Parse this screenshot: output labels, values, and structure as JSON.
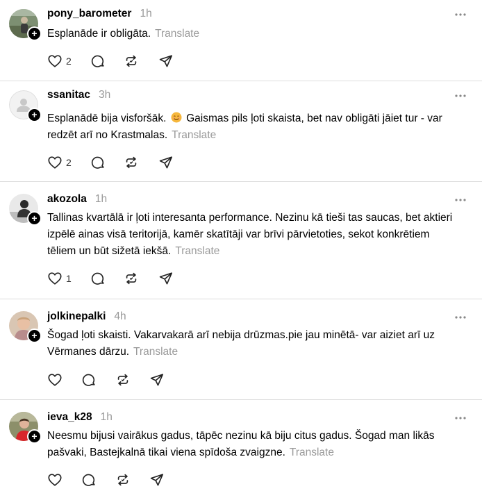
{
  "posts": [
    {
      "username": "pony_barometer",
      "time": "1h",
      "text": "Esplanāde ir obligāta.",
      "translate": "Translate",
      "likes": "2",
      "avatar": "photo-person-outdoors",
      "has_emoji": false
    },
    {
      "username": "ssanitac",
      "time": "3h",
      "text": "Esplanādē bija visforšāk.",
      "text_after_emoji": "Gaismas pils ļoti skaista, bet nav obligāti jāiet tur - var redzēt arī no Krastmalas.",
      "translate": "Translate",
      "likes": "2",
      "avatar": "default-person-placeholder",
      "has_emoji": true
    },
    {
      "username": "akozola",
      "time": "1h",
      "text": "Tallinas kvartālā ir ļoti interesanta performance. Nezinu kā tieši tas saucas, bet aktieri izpēlē ainas visā teritorijā, kamēr skatītāji var brīvi pārvietoties, sekot konkrētiem tēliem un būt sižetā iekšā.",
      "translate": "Translate",
      "likes": "1",
      "avatar": "photo-person-bw",
      "has_emoji": false
    },
    {
      "username": "jolkinepalki",
      "time": "4h",
      "text": "Šogad ļoti skaisti. Vakarvakarā arī nebija drūzmas.pie jau minētā- var aiziet arī uz Vērmanes dārzu.",
      "translate": "Translate",
      "likes": "",
      "avatar": "photo-person-woman",
      "has_emoji": false
    },
    {
      "username": "ieva_k28",
      "time": "1h",
      "text": "Neesmu bijusi vairākus gadus, tāpēc nezinu kā biju citus gadus. Šogad man likās pašvaki, Bastejkalnā tikai viena spīdoša zvaigzne.",
      "translate": "Translate",
      "likes": "",
      "avatar": "photo-person-red",
      "has_emoji": false
    }
  ],
  "icons": {
    "like": "heart-icon",
    "reply": "comment-icon",
    "repost": "repost-icon",
    "share": "send-icon",
    "more": "more-icon",
    "follow": "plus-icon"
  },
  "colors": {
    "muted": "#999999",
    "divider": "#dcdcdc",
    "text": "#000000"
  }
}
